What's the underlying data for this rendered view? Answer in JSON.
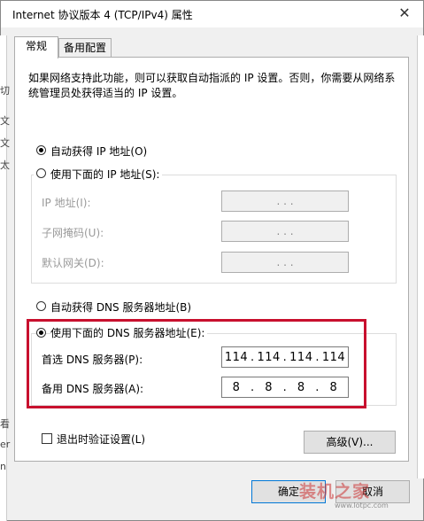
{
  "window": {
    "title": "Internet 协议版本 4 (TCP/IPv4) 属性",
    "close_glyph": "✕"
  },
  "background": {
    "left_glyphs": [
      "切",
      "文",
      "文",
      "太",
      "看",
      "er",
      "n"
    ]
  },
  "tabs": [
    {
      "label": "常规",
      "selected": true
    },
    {
      "label": "备用配置",
      "selected": false
    }
  ],
  "intro": "如果网络支持此功能，则可以获取自动指派的 IP 设置。否则，你需要从网络系统管理员处获得适当的 IP 设置。",
  "ip": {
    "auto_label": "自动获得 IP 地址(O)",
    "auto_selected": true,
    "manual_label": "使用下面的 IP 地址(S):",
    "fields": [
      {
        "label": "IP 地址(I):",
        "value": ". . ."
      },
      {
        "label": "子网掩码(U):",
        "value": ". . ."
      },
      {
        "label": "默认网关(D):",
        "value": ". . ."
      }
    ]
  },
  "dns": {
    "auto_label": "自动获得 DNS 服务器地址(B)",
    "manual_label": "使用下面的 DNS 服务器地址(E):",
    "manual_selected": true,
    "preferred_label": "首选 DNS 服务器(P):",
    "preferred": [
      "114",
      "114",
      "114",
      "114"
    ],
    "alternate_label": "备用 DNS 服务器(A):",
    "alternate": [
      "8",
      "8",
      "8",
      "8"
    ]
  },
  "validate_label": "退出时验证设置(L)",
  "advanced_label": "高级(V)...",
  "ok_label": "确定",
  "cancel_label": "取消",
  "watermark": {
    "text": "装机之家",
    "sub": "www.lotpc.com"
  },
  "colors": {
    "highlight_frame": "#c8102e",
    "default_button_border": "#0078d7"
  }
}
